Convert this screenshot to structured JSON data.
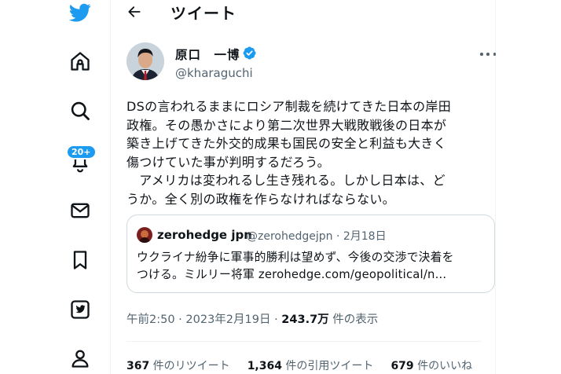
{
  "colors": {
    "brand": "#1d9bf0",
    "text": "#0f1419",
    "secondary": "#536471",
    "border": "#cfd9de"
  },
  "sidebar": {
    "items": [
      {
        "icon": "twitter-logo-icon"
      },
      {
        "icon": "home-icon"
      },
      {
        "icon": "search-icon"
      },
      {
        "icon": "notifications-icon",
        "badge": "20+"
      },
      {
        "icon": "messages-icon"
      },
      {
        "icon": "bookmarks-icon"
      },
      {
        "icon": "twitter-blue-icon"
      },
      {
        "icon": "profile-icon"
      }
    ]
  },
  "header": {
    "title": "ツイート",
    "back_icon": "arrow-left-icon"
  },
  "tweet": {
    "author_name": "原口　一博",
    "author_handle": "@kharaguchi",
    "verified_icon": "verified-badge-icon",
    "more_icon": "more-icon",
    "text": "DSの言われるままにロシア制裁を続けてきた日本の岸田\n政権。その愚かさにより第二次世界大戦敗戦後の日本が\n築き上げてきた外交的成果も国民の安全と利益も大きく\n傷つけていた事が判明するだろう。\n　アメリカは変われるし生き残れる。しかし日本は、ど\nうか。全く別の政権を作らなければならない。",
    "quote": {
      "name": "zerohedge jpn",
      "meta": "@zerohedgejpn · 2月18日",
      "text": "ウクライナ紛争に軍事的勝利は望めず、今後の交渉で決着を\nつける。ミルリー将軍 zerohedge.com/geopolitical/n..."
    },
    "timestamp": "午前2:50 · 2023年2月19日 · ",
    "views_count": "243.7万",
    "views_label": " 件の表示",
    "stats": {
      "retweets_count": "367",
      "retweets_label": " 件のリツイート",
      "quotes_count": "1,364",
      "quotes_label": " 件の引用ツイート",
      "likes_count": "679",
      "likes_label": " 件のいいね"
    }
  }
}
